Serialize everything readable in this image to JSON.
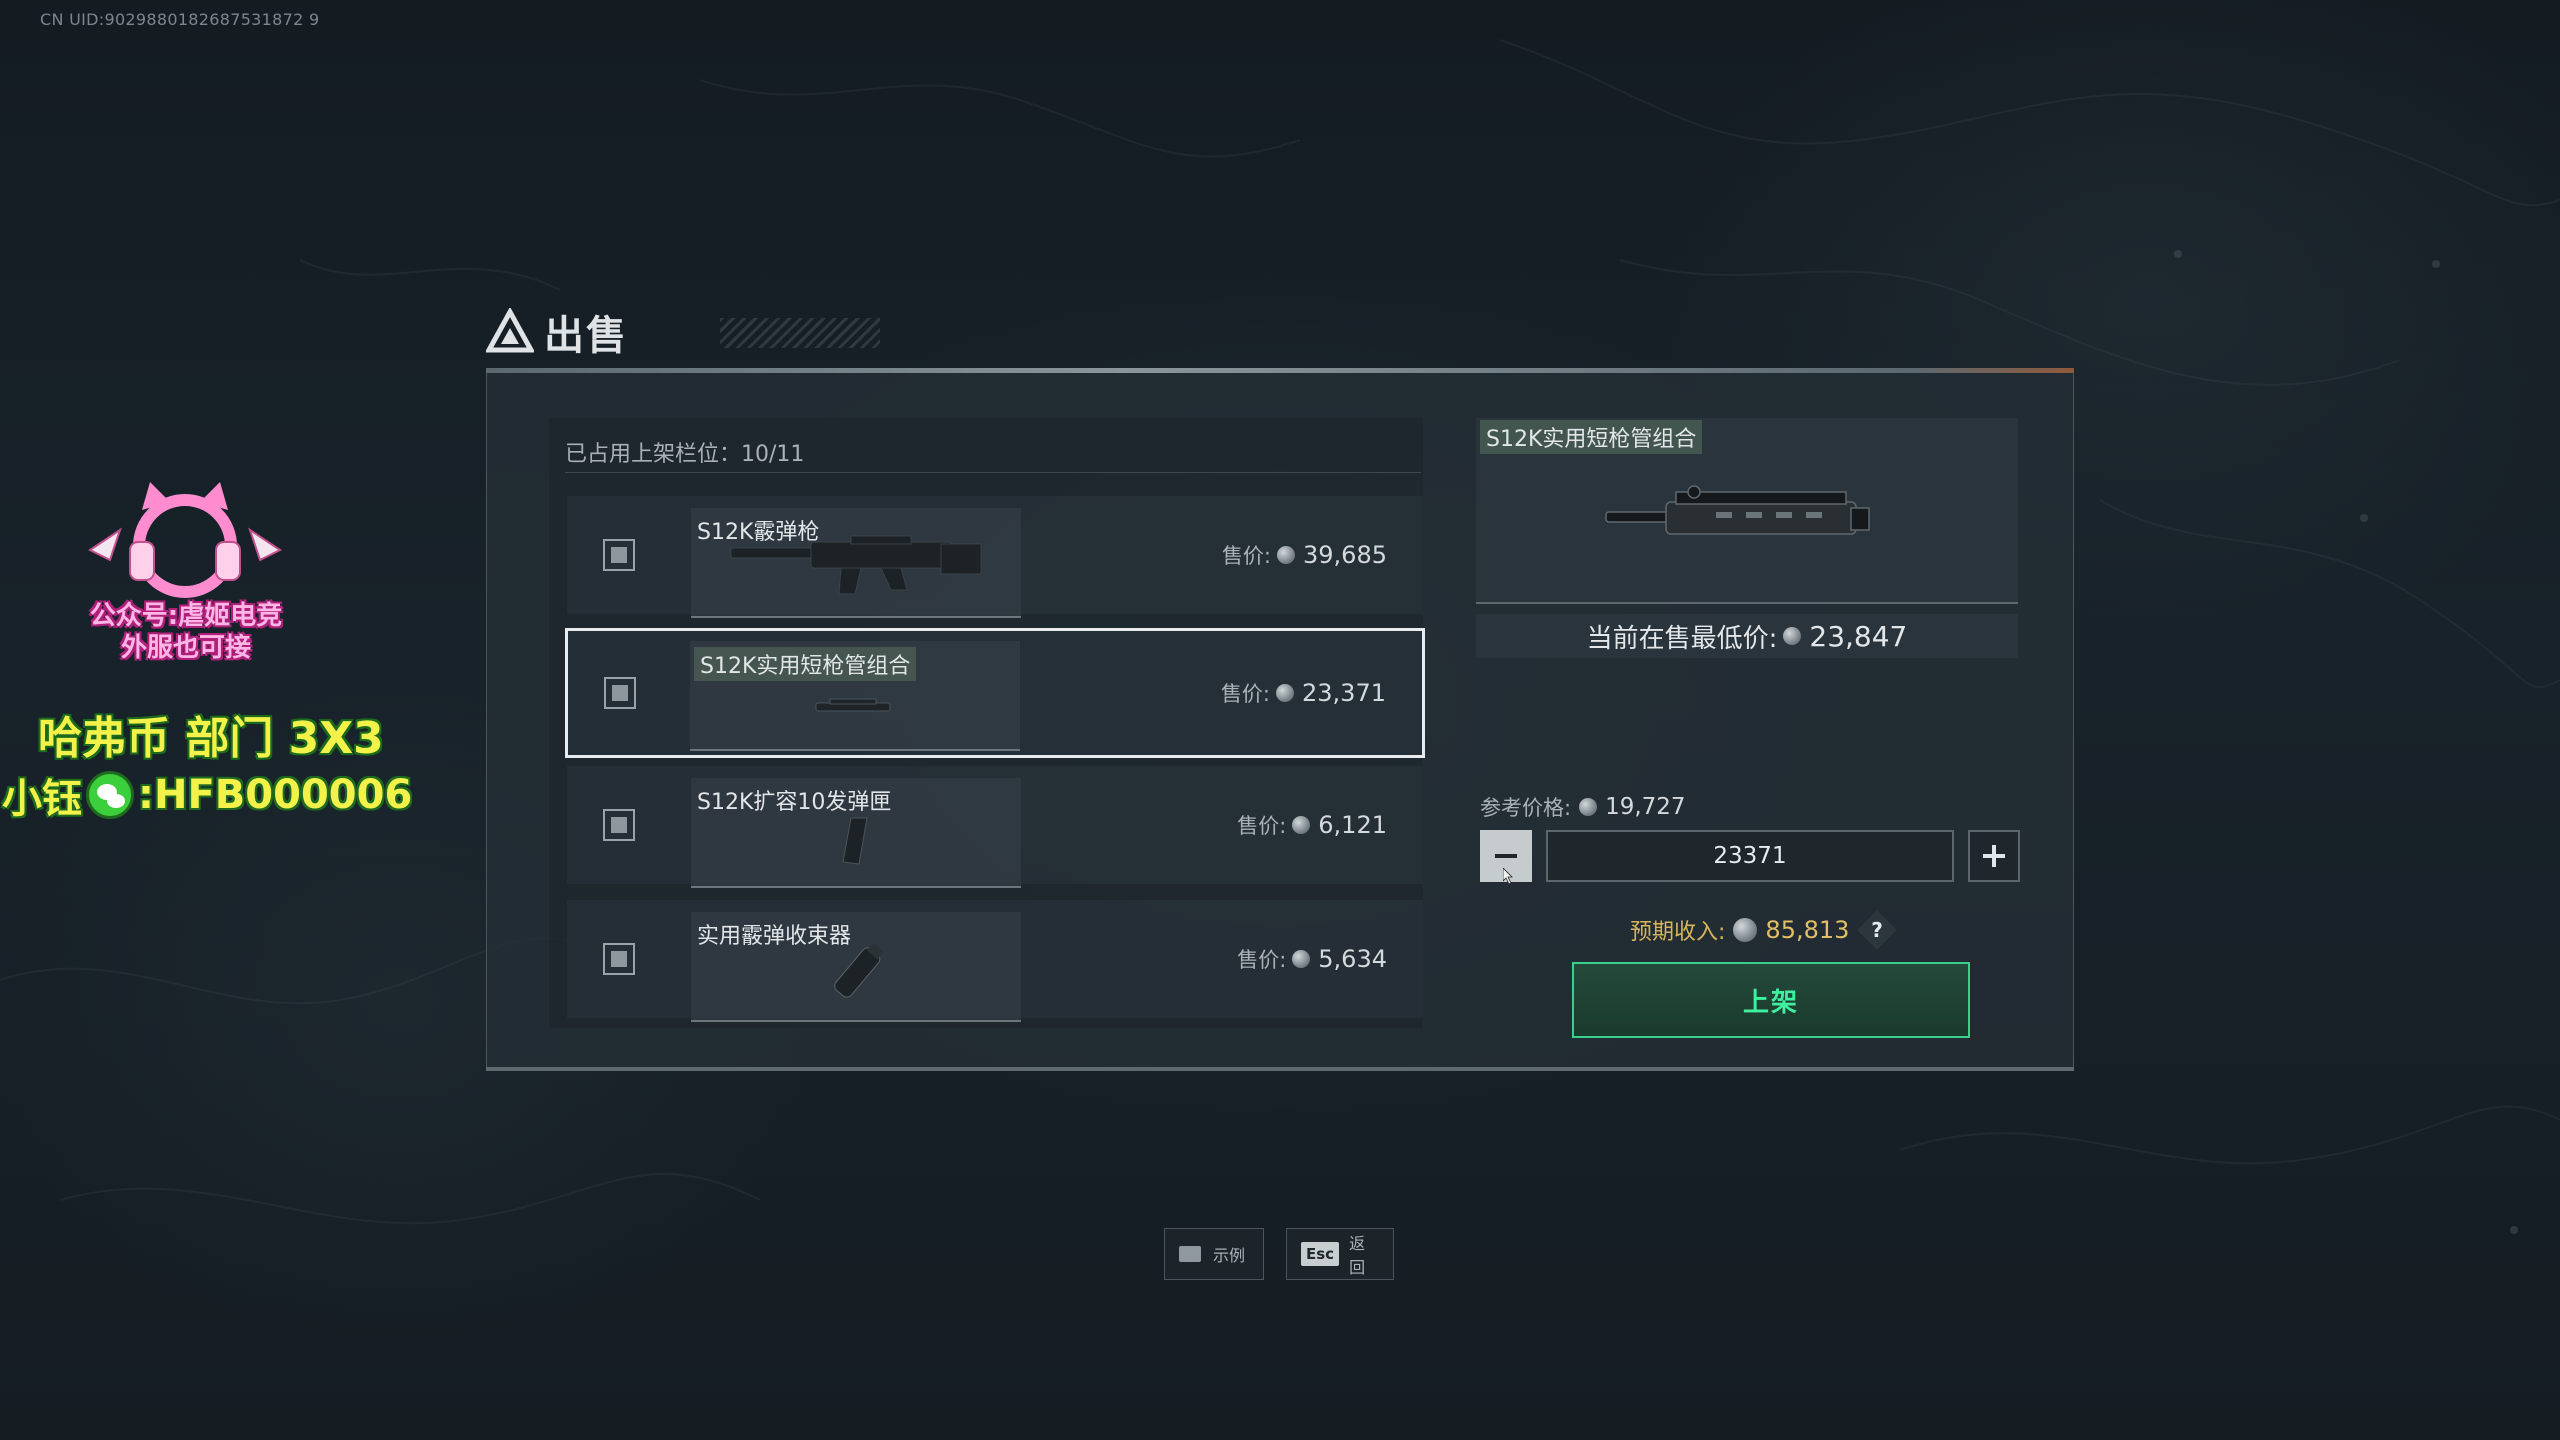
{
  "uid": "CN UID:9029880182687531872 9",
  "title": "出售",
  "slots": "已占用上架栏位：10/11",
  "items": [
    {
      "name": "S12K霰弹枪",
      "price_label": "售价:",
      "price": "39,685"
    },
    {
      "name": "S12K实用短枪管组合",
      "price_label": "售价:",
      "price": "23,371"
    },
    {
      "name": "S12K扩容10发弹匣",
      "price_label": "售价:",
      "price": "6,121"
    },
    {
      "name": "实用霰弹收束器",
      "price_label": "售价:",
      "price": "5,634"
    }
  ],
  "selected_index": 1,
  "detail": {
    "name": "S12K实用短枪管组合",
    "lowest_label": "当前在售最低价:",
    "lowest_value": "23,847",
    "ref_label": "参考价格:",
    "ref_value": "19,727",
    "quantity": "23371",
    "income_label": "预期收入:",
    "income_value": "85,813",
    "help": "?",
    "list_button": "上架"
  },
  "hints": [
    {
      "key": "",
      "label": "示例"
    },
    {
      "key": "Esc",
      "label": "返回"
    }
  ],
  "overlay": {
    "logo_text_1": "公众号:虐姬电竞",
    "logo_text_2": "外服也可接",
    "line1": "哈弗币 部门 3X3",
    "line2_prefix": "小钰",
    "line2_suffix": ":HFB000006"
  },
  "colors": {
    "accent_green": "#3ad08a",
    "income_gold": "#d8b45b",
    "label_green_bg": "#485c52"
  }
}
